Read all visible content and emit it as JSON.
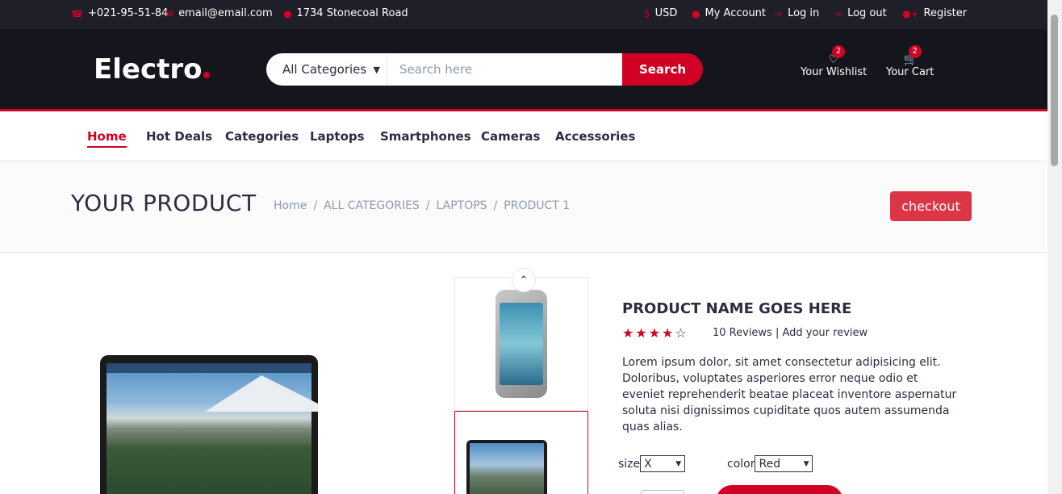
{
  "topbar": {
    "phone": "+021-95-51-84",
    "email": "email@email.com",
    "address": "1734 Stonecoal Road",
    "currency": "USD",
    "my_account": "My Account",
    "login": "Log in",
    "logout": "Log out",
    "register": "Register"
  },
  "header": {
    "logo": "Electro",
    "category_selected": "All Categories",
    "search_placeholder": "Search here",
    "search_button": "Search",
    "wishlist_label": "Your Wishlist",
    "wishlist_count": "2",
    "cart_label": "Your Cart",
    "cart_count": "2"
  },
  "nav": {
    "items": [
      "Home",
      "Hot Deals",
      "Categories",
      "Laptops",
      "Smartphones",
      "Cameras",
      "Accessories"
    ],
    "active": "Home"
  },
  "breadcrumb": {
    "title": "YOUR PRODUCT",
    "crumbs": [
      "Home",
      "ALL CATEGORIES",
      "LAPTOPS",
      "PRODUCT 1"
    ],
    "checkout": "checkout"
  },
  "product": {
    "name": "PRODUCT NAME GOES HERE",
    "rating": 4,
    "rating_max": 5,
    "reviews": "10 Reviews | Add your review",
    "description": "Lorem ipsum dolor, sit amet consectetur adipisicing elit. Doloribus, voluptates asperiores error neque odio et eveniet reprehenderit beatae placeat inventore aspernatur soluta nisi dignissimos cupiditate quos autem assumenda quas alias.",
    "size_label": "size",
    "size_value": "X",
    "color_label": "color",
    "color_value": "Red"
  },
  "colors": {
    "accent": "#d10024",
    "dark": "#15161d",
    "topbar": "#1e1f29",
    "checkout": "#dc3545"
  }
}
